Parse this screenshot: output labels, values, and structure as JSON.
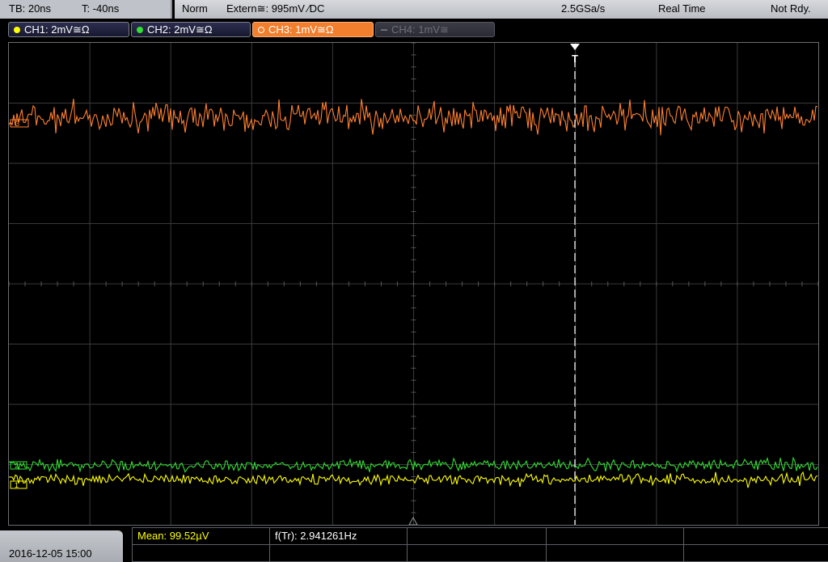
{
  "top": {
    "timebase": "TB: 20ns",
    "trigger_time": "T: -40ns",
    "mode": "Norm",
    "trigger_source": "Extern≅: 995mV ∕DC",
    "sample_rate": "2.5GSa/s",
    "acq_mode": "Real Time",
    "run_state": "Not Rdy."
  },
  "channels": [
    {
      "label": "CH1: 2mV≅Ω",
      "color": "#ffff00",
      "state": "on"
    },
    {
      "label": "CH2: 2mV≅Ω",
      "color": "#33dd33",
      "state": "on"
    },
    {
      "label": "CH3: 1mV≅Ω",
      "color": "#ff8030",
      "state": "selected"
    },
    {
      "label": "CH4: 1mV≅",
      "color": "#6d6f78",
      "state": "off"
    }
  ],
  "markers": {
    "trigger_marker": "T",
    "ch1_marker": "1",
    "ch2_marker": "2",
    "ch3_marker": "3"
  },
  "bottom": {
    "datetime": "2016-12-05 15:00",
    "measurements": [
      {
        "label": "Mean: 99.52µV",
        "color": "#ffff00"
      },
      {
        "label": "f(Tr): 2.941261Hz",
        "color": "#ffffff"
      }
    ]
  }
}
